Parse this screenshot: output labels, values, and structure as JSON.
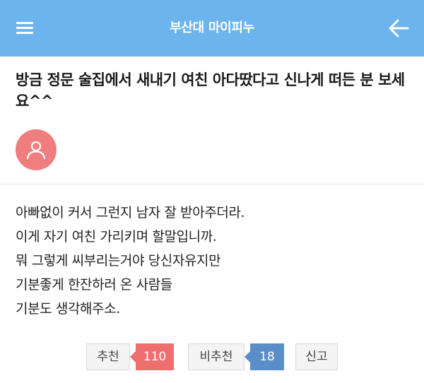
{
  "header": {
    "title": "부산대 마이피누",
    "menu_icon": "hamburger-menu-icon",
    "back_icon": "arrow-left-icon",
    "bg_color": "#6cb4ee"
  },
  "post": {
    "title": "방금 정문 술집에서 새내기 여친 아다땄다고 신나게 떠든 분 보세요^^",
    "avatar_icon": "user-icon",
    "avatar_color": "#f07e7e",
    "body_lines": [
      "아빠없이 커서 그런지 남자 잘 받아주더라.",
      "이게 자기 여친 가리키며 할말입니까.",
      "뭐 그렇게 씨부리는거야 당신자유지만",
      "기분좋게 한잔하러 온 사람들",
      "기분도 생각해주소."
    ]
  },
  "actions": {
    "recommend_label": "추천",
    "recommend_count": "110",
    "recommend_color": "#ef6f6f",
    "notrecommend_label": "비추천",
    "notrecommend_count": "18",
    "notrecommend_color": "#5b8ec8",
    "report_label": "신고"
  }
}
